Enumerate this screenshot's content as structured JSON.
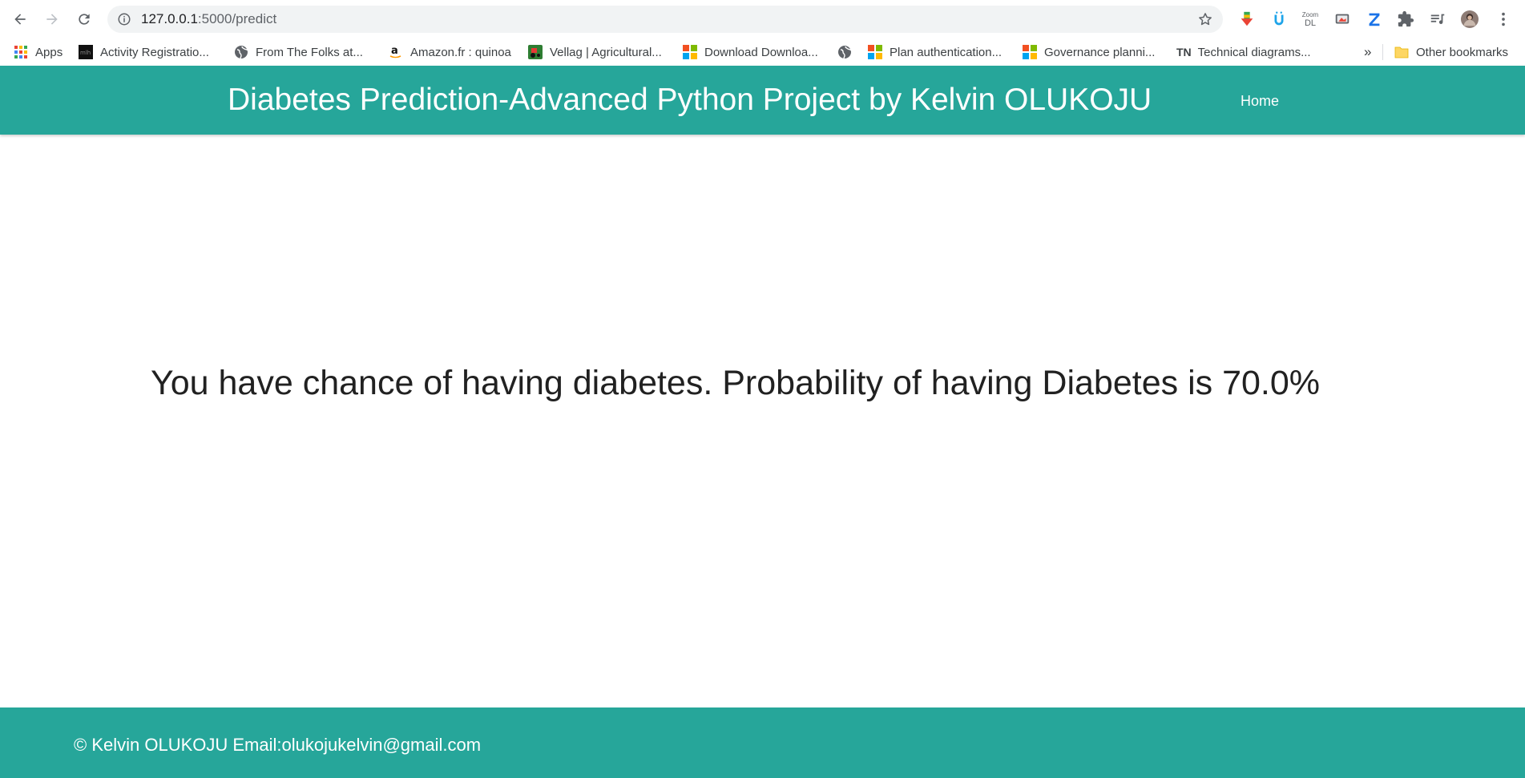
{
  "browser": {
    "url_host": "127.0.0.1",
    "url_path": ":5000/predict",
    "bookmarks": [
      {
        "label": "Apps",
        "icon": "apps-grid-icon"
      },
      {
        "label": "Activity Registratio...",
        "icon": "mlh-icon"
      },
      {
        "label": "From The Folks at...",
        "icon": "globe-icon"
      },
      {
        "label": "Amazon.fr : quinoa",
        "icon": "amazon-icon"
      },
      {
        "label": "Vellag | Agricultural...",
        "icon": "tractor-icon"
      },
      {
        "label": "Download Downloa...",
        "icon": "microsoft-icon"
      },
      {
        "label": "",
        "icon": "globe-icon"
      },
      {
        "label": "Plan authentication...",
        "icon": "microsoft-icon"
      },
      {
        "label": "Governance planni...",
        "icon": "microsoft-icon"
      },
      {
        "label": "Technical diagrams...",
        "icon": "tn-icon",
        "icon_text": "TN"
      }
    ],
    "overflow_label": "»",
    "other_bookmarks_label": "Other bookmarks",
    "zoom_ext_text": [
      "Zoom",
      "DL"
    ]
  },
  "site": {
    "title": "Diabetes Prediction-Advanced Python Project by Kelvin OLUKOJU",
    "nav_home": "Home",
    "result": "You have chance of having diabetes. Probability of having Diabetes is 70.0%",
    "footer": "© Kelvin OLUKOJU Email:olukojukelvin@gmail.com"
  },
  "colors": {
    "brand_teal": "#26a69a",
    "omnibox_bg": "#f1f3f4"
  }
}
